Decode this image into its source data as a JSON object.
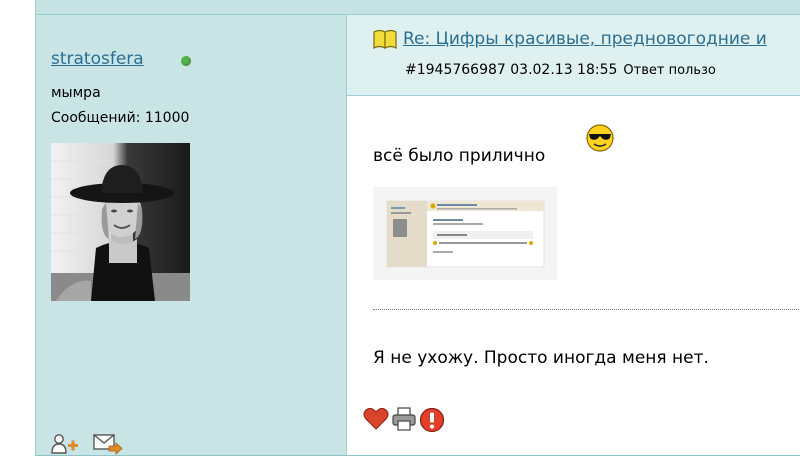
{
  "user": {
    "name": "stratosfera",
    "title": "мымра",
    "posts_line": "Сообщений: 11000"
  },
  "post": {
    "title": "Re: Цифры красивые, предновогодние и",
    "meta": "#1945766987 03.02.13 18:55",
    "reply_label": "Ответ пользо",
    "text": "всё было прилично",
    "signature": "Я не ухожу. Просто иногда меня нет."
  },
  "colors": {
    "sidebar_bg": "#c9e4e5",
    "header_bg": "#dff0f0",
    "link": "#2a6f93",
    "online": "#54b34a",
    "border": "#9ccfd1"
  },
  "icons": {
    "online": "online-status-icon",
    "book": "book-icon",
    "smiley": "sunglasses-smiley-icon",
    "add_friend": "add-friend-icon",
    "send_message": "send-message-icon",
    "like": "heart-icon",
    "print": "printer-icon",
    "report": "warning-icon"
  }
}
